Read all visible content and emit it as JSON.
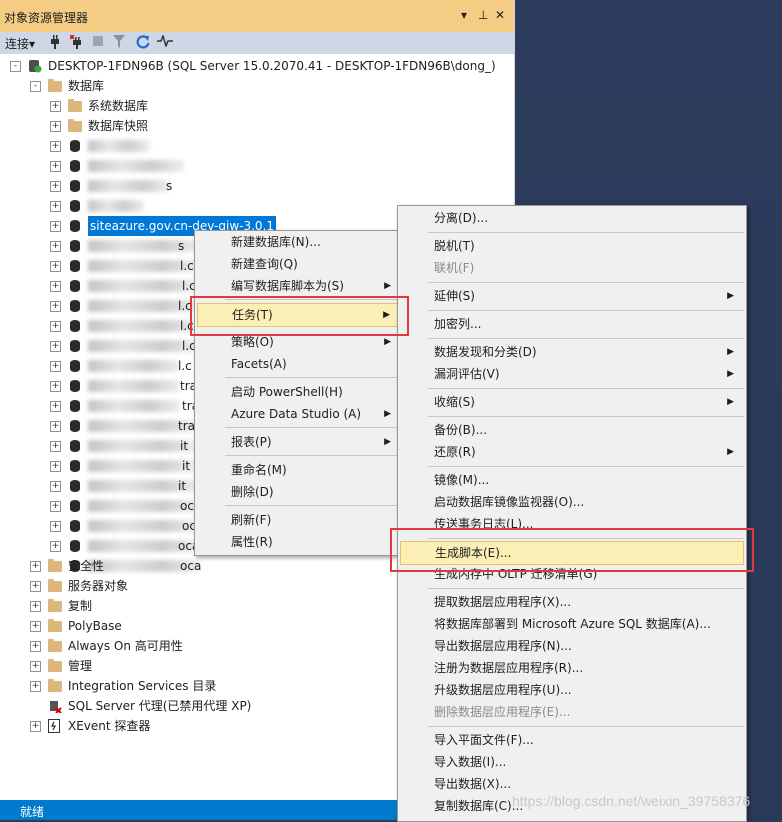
{
  "panel": {
    "title": "对象资源管理器",
    "ctl_pin": "▾",
    "ctl_dock": "⊥",
    "ctl_close": "✕"
  },
  "toolbar": {
    "connect": "连接▾",
    "icons": [
      "plug-icon",
      "disconnect-icon",
      "stop-icon",
      "filter-icon",
      "refresh-icon",
      "activity-icon"
    ]
  },
  "tree": {
    "server": "DESKTOP-1FDN96B (SQL Server 15.0.2070.41 - DESKTOP-1FDN96B\\dong_)",
    "databases": "数据库",
    "system_db": "系统数据库",
    "snapshots": "数据库快照",
    "selected_db": "siteazure.gov.cn-dev-qiw-3.0.1",
    "security": "安全性",
    "server_objects": "服务器对象",
    "replication": "复制",
    "polybase": "PolyBase",
    "always_on": "Always On 高可用性",
    "management": "管理",
    "integration": "Integration Services 目录",
    "agent": "SQL Server 代理(已禁用代理 XP)",
    "xevent": "XEvent 探查器",
    "partial_suffixes": [
      "s",
      "l.c",
      "l.c",
      "l.c",
      "l.c",
      "l.c",
      "l.c",
      "tra",
      "tra",
      "tra",
      "it",
      "it",
      "it",
      "oca",
      "oca",
      "oca",
      "oca"
    ]
  },
  "context_menu": {
    "items": [
      "新建数据库(N)...",
      "新建查询(Q)",
      "编写数据库脚本为(S)",
      "任务(T)",
      "策略(O)",
      "Facets(A)",
      "启动 PowerShell(H)",
      "Azure Data Studio (A)",
      "报表(P)",
      "重命名(M)",
      "删除(D)",
      "刷新(F)",
      "属性(R)"
    ]
  },
  "tasks_menu": {
    "items": [
      "分离(D)...",
      "脱机(T)",
      "联机(F)",
      "延伸(S)",
      "加密列...",
      "数据发现和分类(D)",
      "漏洞评估(V)",
      "收缩(S)",
      "备份(B)...",
      "还原(R)",
      "镜像(M)...",
      "启动数据库镜像监视器(O)...",
      "传送事务日志(L)...",
      "生成脚本(E)...",
      "生成内存中 OLTP 迁移清单(G)",
      "提取数据层应用程序(X)...",
      "将数据库部署到 Microsoft Azure SQL 数据库(A)...",
      "导出数据层应用程序(N)...",
      "注册为数据层应用程序(R)...",
      "升级数据层应用程序(U)...",
      "删除数据层应用程序(E)...",
      "导入平面文件(F)...",
      "导入数据(I)...",
      "导出数据(X)...",
      "复制数据库(C)..."
    ]
  },
  "status": {
    "text": "就绪"
  },
  "watermark": "https://blog.csdn.net/weixin_39758376",
  "colors": {
    "title_bg": "#f5cc84",
    "selection": "#0078d7",
    "highlight": "#fbefb6",
    "status_bar": "#007acc",
    "annotation": "#e0393e"
  }
}
